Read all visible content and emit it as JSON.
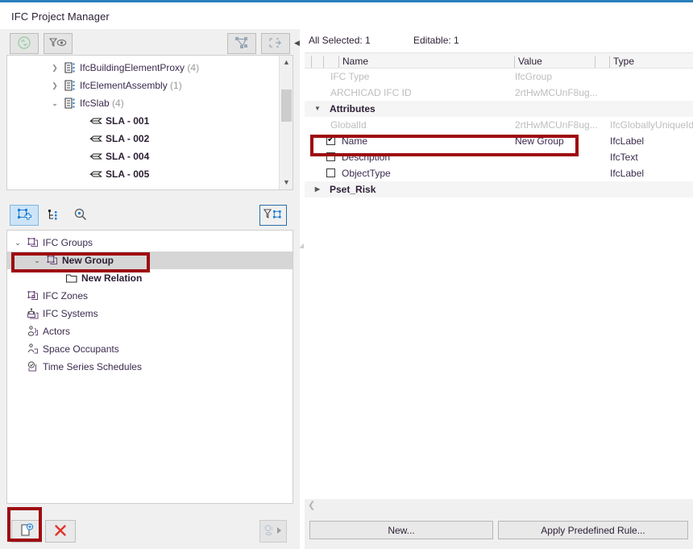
{
  "window": {
    "title": "IFC Project Manager",
    "accent": "#2a7fbd",
    "callout_color": "#9e0c11"
  },
  "upper_panel": {
    "toolbar": {
      "refresh_icon": "refresh-sync-icon",
      "filter_view_icon": "filter-eye-icon",
      "select_elements_icon": "select-elements-icon",
      "show_in_3d_icon": "export-selection-icon",
      "collapse_icon": "collapse-arrow-icon"
    },
    "tree": [
      {
        "label": "IfcBuildingElementProxy",
        "count": "(4)",
        "expander": "collapsed",
        "indent": 1,
        "icon": "ifc-entity-icon",
        "bold": false
      },
      {
        "label": "IfcElementAssembly",
        "count": "(1)",
        "expander": "collapsed",
        "indent": 1,
        "icon": "ifc-entity-icon",
        "bold": false
      },
      {
        "label": "IfcSlab",
        "count": "(4)",
        "expander": "expanded",
        "indent": 1,
        "icon": "ifc-entity-icon",
        "bold": false
      },
      {
        "label": "SLA - 001",
        "count": "",
        "expander": "none",
        "indent": 2,
        "icon": "slab-icon",
        "bold": true
      },
      {
        "label": "SLA - 002",
        "count": "",
        "expander": "none",
        "indent": 2,
        "icon": "slab-icon",
        "bold": true
      },
      {
        "label": "SLA - 004",
        "count": "",
        "expander": "none",
        "indent": 2,
        "icon": "slab-icon",
        "bold": true
      },
      {
        "label": "SLA - 005",
        "count": "",
        "expander": "none",
        "indent": 2,
        "icon": "slab-icon",
        "bold": true
      }
    ],
    "scrollbar": {
      "up": "▲",
      "down": "▼"
    }
  },
  "lower_panel": {
    "toolbar": {
      "new_group_icon": "new-ifc-group-icon",
      "tree_view_icon": "tree-hierarchy-icon",
      "search_icon": "search-icon",
      "filter_selection_icon": "filter-selection-icon"
    },
    "tree": [
      {
        "label": "IFC Groups",
        "expander": "expanded",
        "indent": 0,
        "icon": "ifc-groups-icon",
        "bold": false,
        "selected": false
      },
      {
        "label": "New Group",
        "expander": "expanded",
        "indent": 1,
        "icon": "ifc-group-icon",
        "bold": true,
        "selected": true
      },
      {
        "label": "New Relation",
        "expander": "none",
        "indent": 2,
        "icon": "folder-icon",
        "bold": true,
        "selected": false
      },
      {
        "label": "IFC Zones",
        "expander": "none",
        "indent": 0,
        "icon": "ifc-zones-icon",
        "bold": false,
        "selected": false
      },
      {
        "label": "IFC Systems",
        "expander": "none",
        "indent": 0,
        "icon": "ifc-systems-icon",
        "bold": false,
        "selected": false
      },
      {
        "label": "Actors",
        "expander": "none",
        "indent": 0,
        "icon": "actors-icon",
        "bold": false,
        "selected": false
      },
      {
        "label": "Space Occupants",
        "expander": "none",
        "indent": 0,
        "icon": "space-occupants-icon",
        "bold": false,
        "selected": false
      },
      {
        "label": "Time Series Schedules",
        "expander": "none",
        "indent": 0,
        "icon": "time-series-icon",
        "bold": false,
        "selected": false
      }
    ],
    "bottom_bar": {
      "new_relation_icon": "new-relation-icon",
      "delete_icon": "delete-x-icon",
      "assign_icon": "assign-icon",
      "assign_more_icon": "triangle-right-icon"
    }
  },
  "properties": {
    "status": {
      "all_selected_label": "All Selected:",
      "all_selected_value": "1",
      "editable_label": "Editable:",
      "editable_value": "1"
    },
    "columns": [
      "Name",
      "Value",
      "Type"
    ],
    "rows": [
      {
        "name": "IFC Type",
        "value": "IfcGroup",
        "type": "",
        "style": "disabled",
        "checkbox": "none",
        "expander": "none"
      },
      {
        "name": "ARCHICAD IFC ID",
        "value": "2rtHwMCUnF8ug...",
        "type": "",
        "style": "disabled",
        "checkbox": "none",
        "expander": "none"
      },
      {
        "name": "Attributes",
        "value": "",
        "type": "",
        "style": "group",
        "checkbox": "none",
        "expander": "expanded"
      },
      {
        "name": "GlobalId",
        "value": "2rtHwMCUnF8ug...",
        "type": "IfcGloballyUniqueId",
        "style": "disabled",
        "checkbox": "none",
        "expander": "none"
      },
      {
        "name": "Name",
        "value": "New Group",
        "type": "IfcLabel",
        "style": "normal",
        "checkbox": "checked",
        "expander": "none"
      },
      {
        "name": "Description",
        "value": "",
        "type": "IfcText",
        "style": "normal",
        "checkbox": "unchecked",
        "expander": "none"
      },
      {
        "name": "ObjectType",
        "value": "",
        "type": "IfcLabel",
        "style": "normal",
        "checkbox": "unchecked",
        "expander": "none"
      },
      {
        "name": "Pset_Risk",
        "value": "",
        "type": "",
        "style": "group",
        "checkbox": "none",
        "expander": "collapsed"
      }
    ],
    "hscroll_left_arrow": "❮",
    "buttons": {
      "new": "New...",
      "apply_rule": "Apply Predefined Rule..."
    }
  }
}
